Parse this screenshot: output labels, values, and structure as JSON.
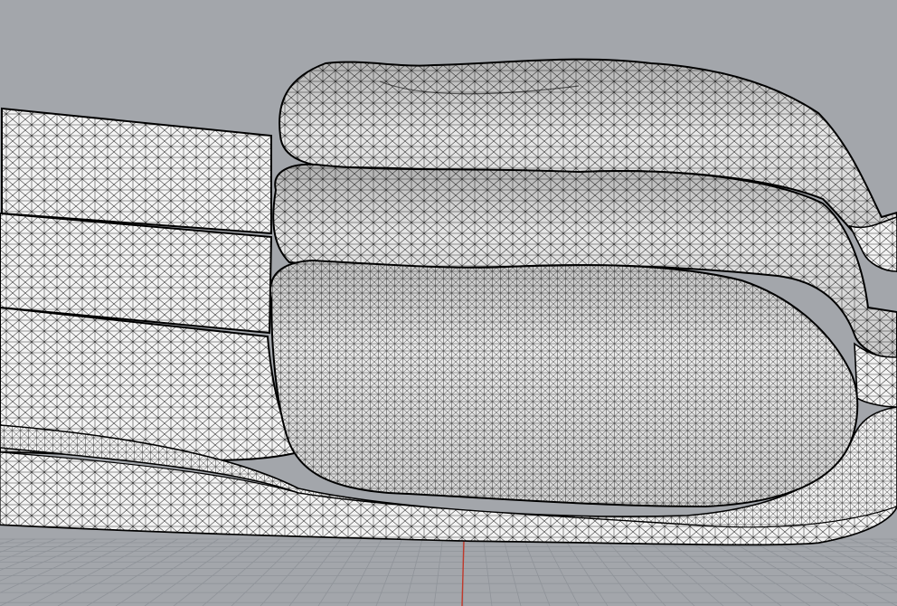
{
  "viewport": {
    "background_color": "#a3a6ab",
    "grid_color": "#8f9399",
    "axis_color": "#c0392b",
    "mesh_fill_color": "#f4f4f4",
    "mesh_line_color": "#111111",
    "display_mode": "wireframe-shaded",
    "grid_visible": true
  },
  "mesh": {
    "name": "mesh-object",
    "parts": [
      "rear-slab-top",
      "rear-slab-middle",
      "rear-slab-bottom",
      "upper-lobe",
      "middle-lobe",
      "lower-lobe"
    ]
  }
}
